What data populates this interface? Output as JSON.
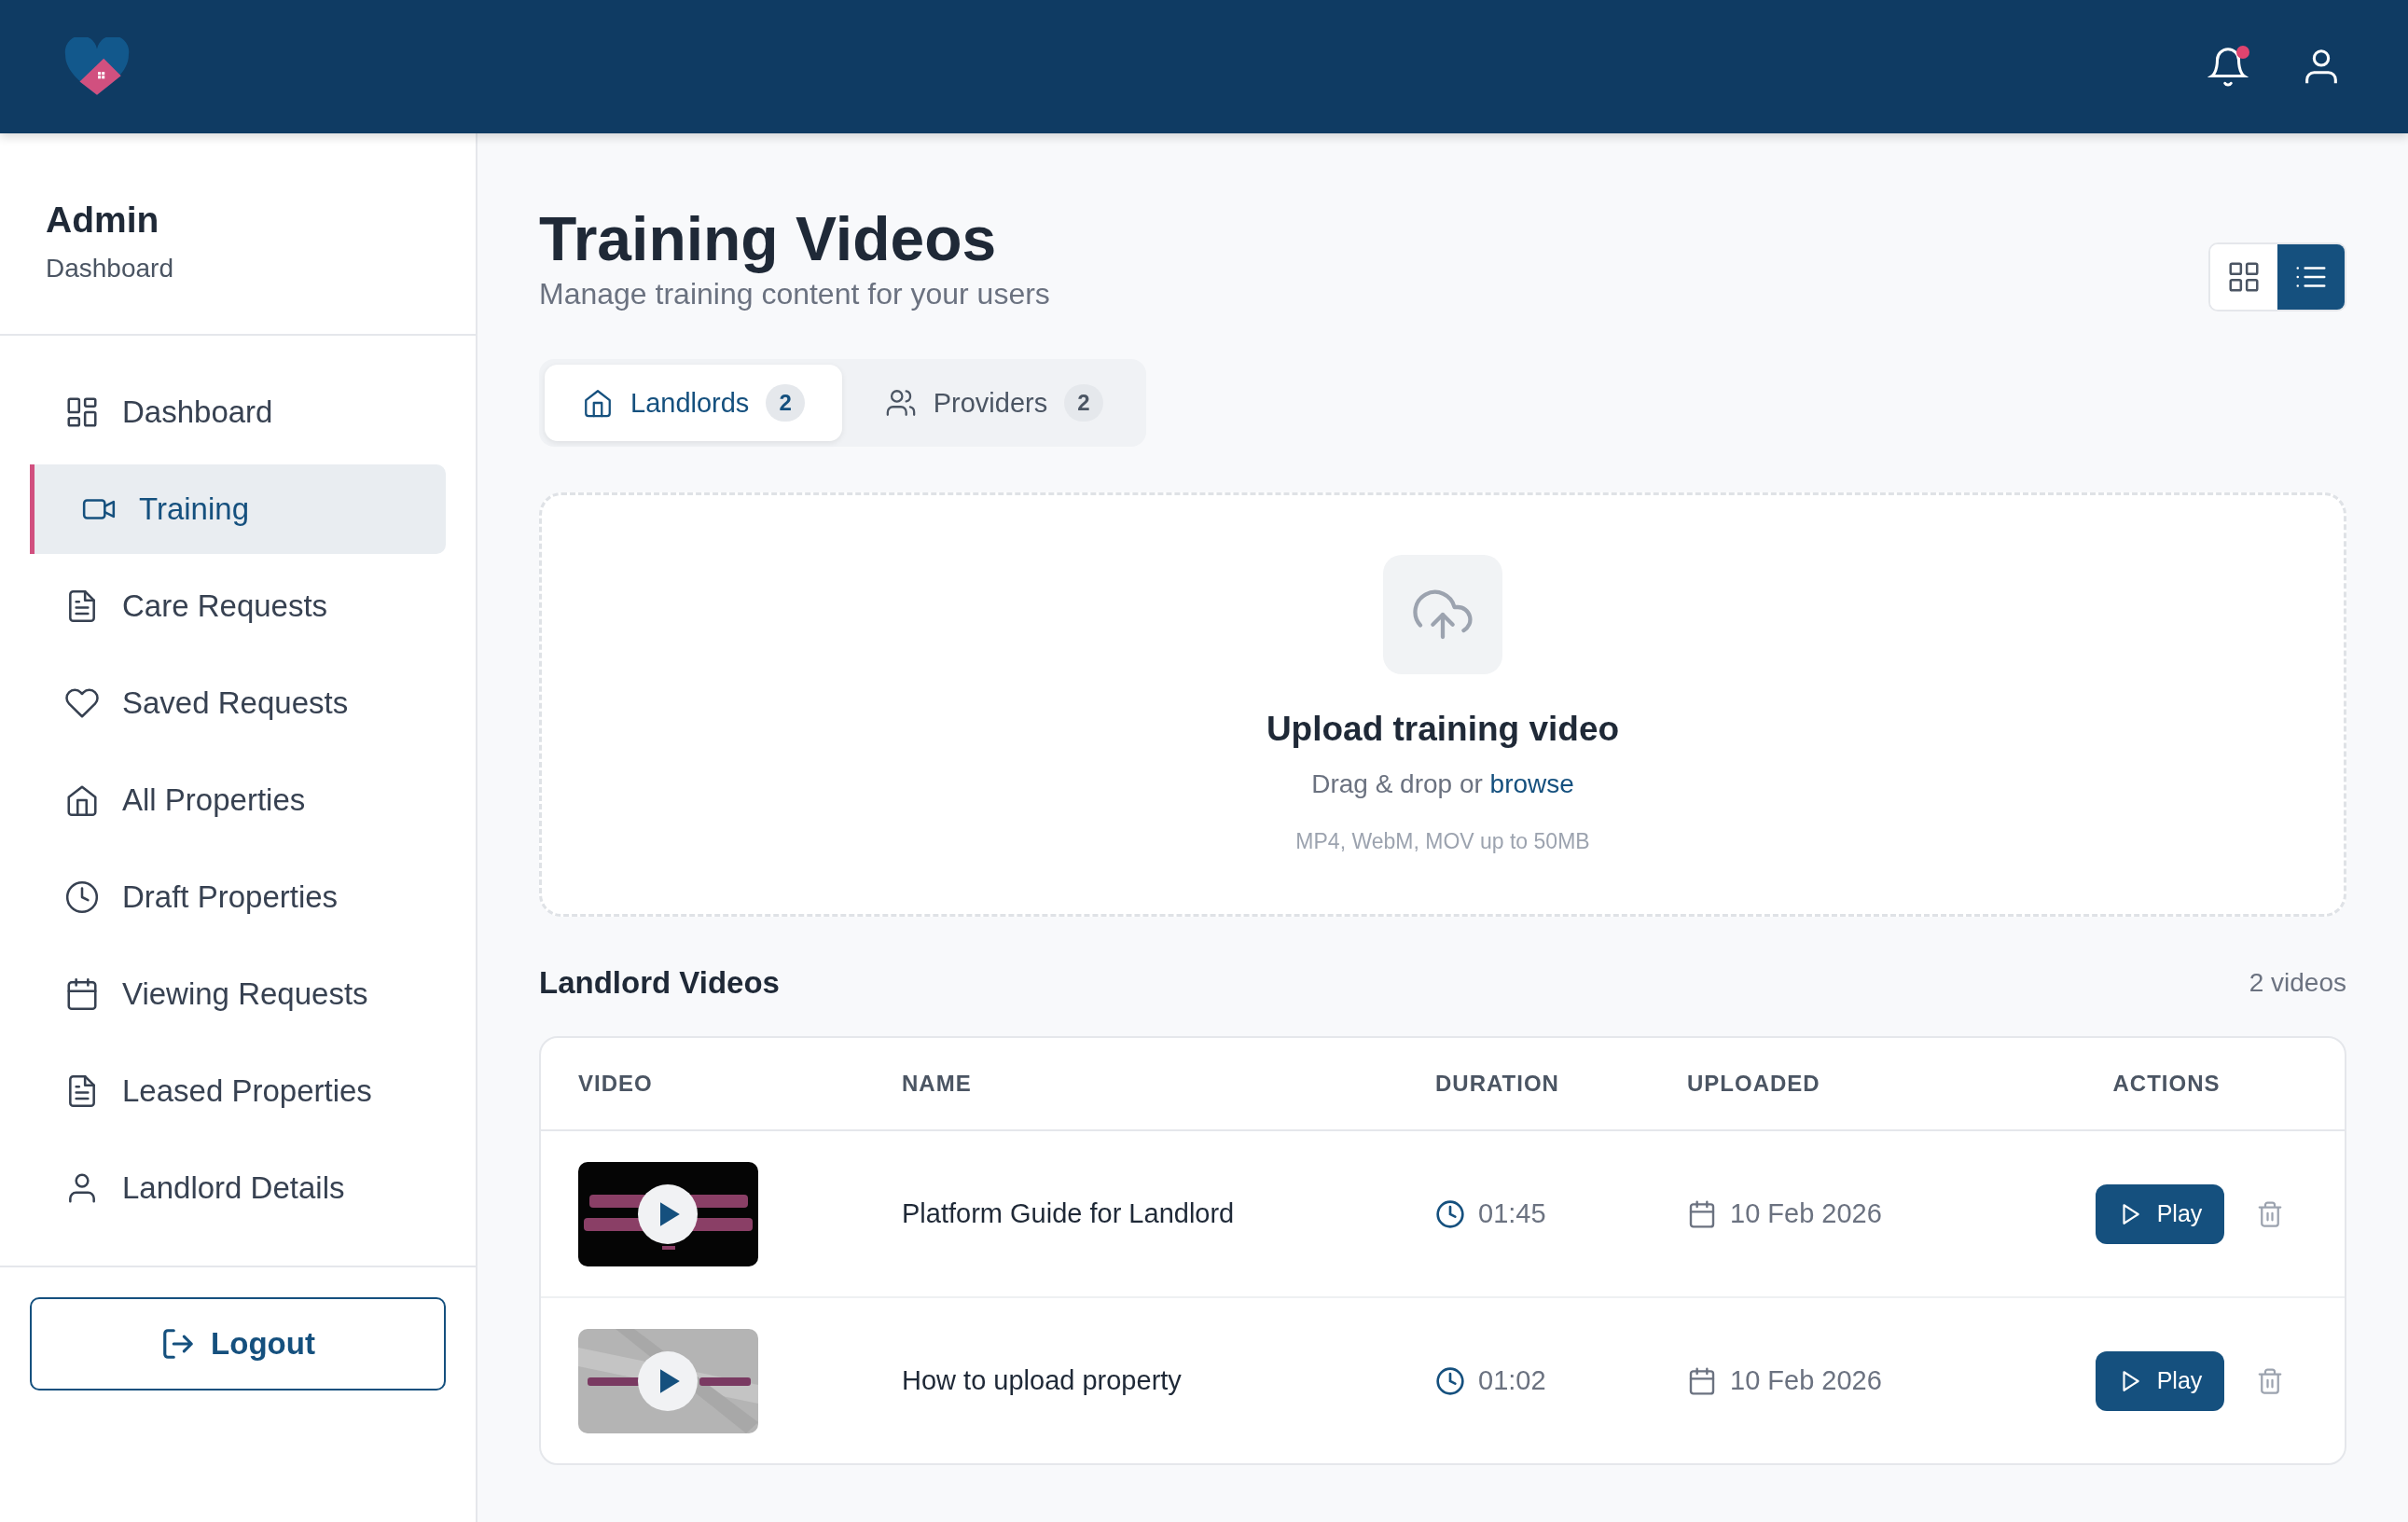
{
  "header": {
    "notifications": {
      "unread": true
    }
  },
  "sidebar": {
    "title": "Admin",
    "subtitle": "Dashboard",
    "items": [
      {
        "label": "Dashboard",
        "kind": "grid",
        "selected": false
      },
      {
        "label": "Training",
        "kind": "video",
        "selected": true
      },
      {
        "label": "Care Requests",
        "kind": "doc",
        "selected": false
      },
      {
        "label": "Saved Requests",
        "kind": "heart",
        "selected": false
      },
      {
        "label": "All Properties",
        "kind": "home",
        "selected": false
      },
      {
        "label": "Draft Properties",
        "kind": "clock",
        "selected": false
      },
      {
        "label": "Viewing Requests",
        "kind": "calendar",
        "selected": false
      },
      {
        "label": "Leased Properties",
        "kind": "doc",
        "selected": false
      },
      {
        "label": "Landlord Details",
        "kind": "user",
        "selected": false
      }
    ],
    "logout": "Logout"
  },
  "page": {
    "title": "Training Videos",
    "subtitle": "Manage training content for your users",
    "view_toggle": [
      {
        "kind": "grid",
        "selected": false
      },
      {
        "kind": "list",
        "selected": true
      }
    ]
  },
  "tabs": [
    {
      "label": "Landlords",
      "kind": "home",
      "count": "2",
      "selected": true
    },
    {
      "label": "Providers",
      "kind": "users",
      "count": "2",
      "selected": false
    }
  ],
  "upload": {
    "title": "Upload training video",
    "hint": "Drag & drop or",
    "link": "browse",
    "formats": "MP4, WebM, MOV up to 50MB"
  },
  "list": {
    "title": "Landlord Videos",
    "count": "2 videos"
  },
  "table": {
    "columns": [
      "VIDEO",
      "NAME",
      "DURATION",
      "UPLOADED",
      "ACTIONS"
    ],
    "rows": [
      {
        "name": "Platform Guide for Landlord",
        "duration": "01:45",
        "uploaded": "10 Feb 2026",
        "action": "Play"
      },
      {
        "name": "How to upload property",
        "duration": "01:02",
        "uploaded": "10 Feb 2026",
        "action": "Play"
      }
    ]
  }
}
